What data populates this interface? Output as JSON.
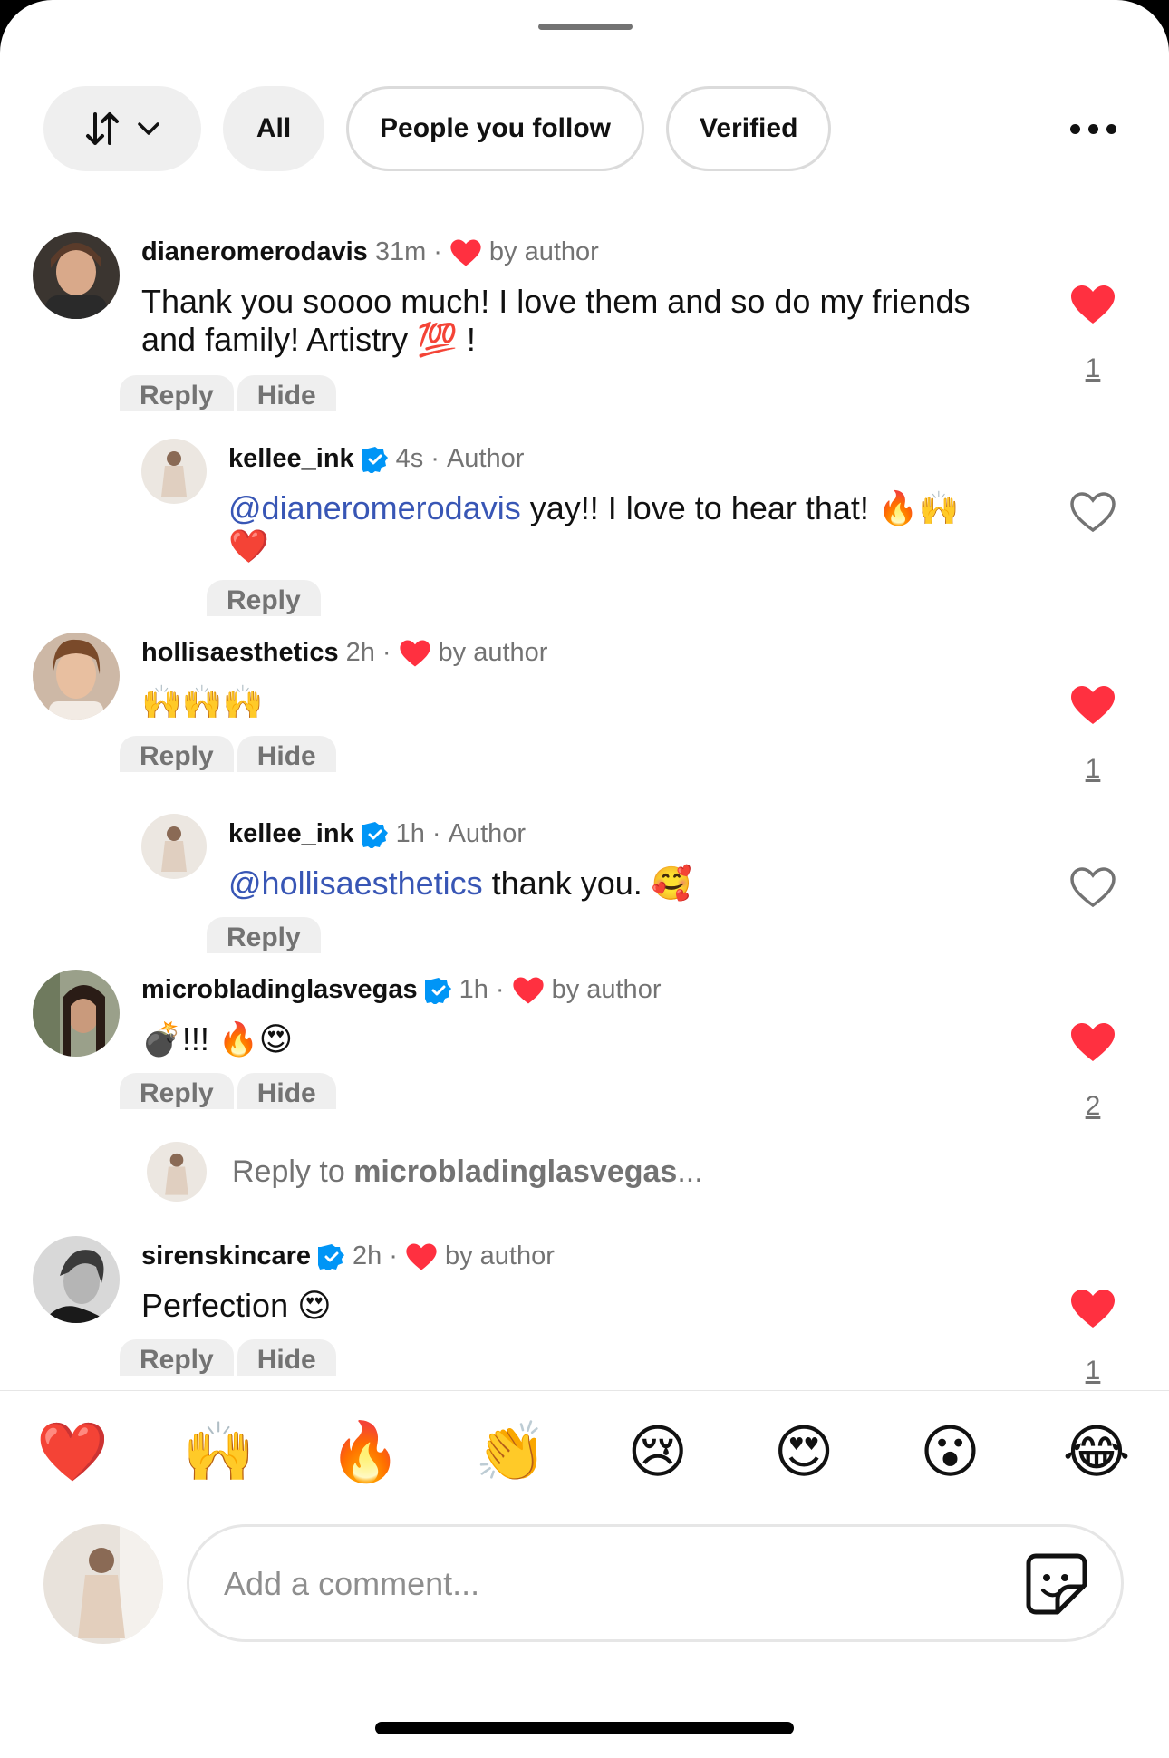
{
  "filters": {
    "all_label": "All",
    "following_label": "People you follow",
    "verified_label": "Verified"
  },
  "comments": [
    {
      "username": "dianeromerodavis",
      "time": "31m",
      "dot": "·",
      "liked_by_author": "by author",
      "text_line1": "Thank you soooo much! I love them and so do my friends",
      "text_line2": "and family!  Artistry 💯 !",
      "reply_label": "Reply",
      "hide_label": "Hide",
      "like_count": "1"
    },
    {
      "username": "kellee_ink",
      "time": "4s",
      "dot": "·",
      "role": "Author",
      "mention": "@dianeromerodavis",
      "text": " yay!! I love to hear that! 🔥🙌",
      "text_line2": "❤️",
      "reply_label": "Reply"
    },
    {
      "username": "hollisaesthetics",
      "time": "2h",
      "dot": "·",
      "liked_by_author": "by author",
      "text": "🙌🙌🙌",
      "reply_label": "Reply",
      "hide_label": "Hide",
      "like_count": "1"
    },
    {
      "username": "kellee_ink",
      "time": "1h",
      "dot": "·",
      "role": "Author",
      "mention": "@hollisaesthetics",
      "text": " thank you. 🥰",
      "reply_label": "Reply"
    },
    {
      "username": "microbladinglasvegas",
      "time": "1h",
      "dot": "·",
      "liked_by_author": "by author",
      "text": "💣!!! 🔥😍",
      "reply_label": "Reply",
      "hide_label": "Hide",
      "like_count": "2"
    },
    {
      "username": "sirenskincare",
      "time": "2h",
      "dot": "·",
      "liked_by_author": "by author",
      "text": "Perfection 😍",
      "reply_label": "Reply",
      "hide_label": "Hide",
      "like_count": "1"
    }
  ],
  "reply_prompt": {
    "prefix": "Reply to ",
    "username": "microbladinglasvegas",
    "suffix": "..."
  },
  "emoji_bar": [
    "❤️",
    "🙌",
    "🔥",
    "👏",
    "😢",
    "😍",
    "😮",
    "😂"
  ],
  "composer": {
    "placeholder": "Add a comment..."
  },
  "colors": {
    "like_red": "#ff3040",
    "verified_blue": "#0095f6",
    "mention_blue": "#3856b5"
  }
}
